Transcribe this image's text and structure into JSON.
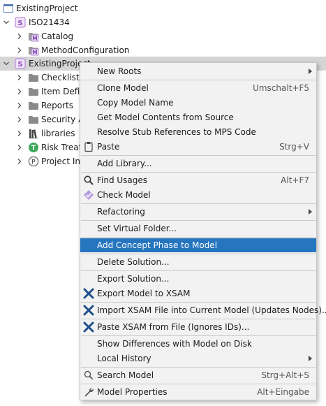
{
  "tree": {
    "root": {
      "label": "ExistingProject",
      "icon": "project-icon"
    },
    "items": [
      {
        "label": "ISO21434",
        "icon": "solution-icon",
        "state": "expanded"
      },
      {
        "label": "Catalog",
        "icon": "model-icon",
        "state": "collapsed"
      },
      {
        "label": "MethodConfiguration",
        "icon": "model-icon",
        "state": "collapsed"
      },
      {
        "label": "ExistingProject",
        "icon": "solution-icon",
        "state": "expanded",
        "selected": true
      },
      {
        "label": "Checklists",
        "icon": "folder-icon",
        "state": "collapsed"
      },
      {
        "label": "Item Defin",
        "icon": "folder-icon",
        "state": "collapsed"
      },
      {
        "label": "Reports",
        "icon": "folder-icon",
        "state": "collapsed"
      },
      {
        "label": "Security An",
        "icon": "folder-icon",
        "state": "collapsed"
      },
      {
        "label": "libraries",
        "icon": "libraries-icon",
        "state": "collapsed"
      },
      {
        "label": "Risk Treatm",
        "icon": "risk-treatment-icon",
        "state": "collapsed"
      },
      {
        "label": "Project Inf",
        "icon": "project-info-icon",
        "state": "collapsed"
      }
    ]
  },
  "menu": {
    "items": [
      {
        "label": "New Roots",
        "submenu": true
      },
      {
        "label": "Clone Model",
        "shortcut": "Umschalt+F5"
      },
      {
        "label": "Copy Model Name"
      },
      {
        "label": "Get Model Contents from Source"
      },
      {
        "label": "Resolve Stub References to MPS Code"
      },
      {
        "label": "Paste",
        "shortcut": "Strg+V",
        "icon": "clipboard-icon"
      },
      {
        "label": "Add Library..."
      },
      {
        "label": "Find Usages",
        "shortcut": "Alt+F7",
        "icon": "magnifier-icon"
      },
      {
        "label": "Check Model",
        "icon": "check-model-icon"
      },
      {
        "label": "Refactoring",
        "submenu": true
      },
      {
        "label": "Set Virtual Folder..."
      },
      {
        "label": "Add Concept Phase to Model",
        "highlighted": true
      },
      {
        "label": "Delete Solution..."
      },
      {
        "label": "Export Solution..."
      },
      {
        "label": "Export Model to XSAM",
        "icon": "xsam-icon"
      },
      {
        "label": "Import XSAM File into Current Model (Updates Nodes)...",
        "icon": "xsam-icon"
      },
      {
        "label": "Paste XSAM from File (Ignores IDs)...",
        "icon": "xsam-icon"
      },
      {
        "label": "Show Differences with Model on Disk"
      },
      {
        "label": "Local History",
        "submenu": true
      },
      {
        "label": "Search Model",
        "shortcut": "Strg+Alt+S",
        "icon": "search-icon"
      },
      {
        "label": "Model Properties",
        "shortcut": "Alt+Eingabe",
        "icon": "wrench-icon"
      }
    ]
  },
  "colors": {
    "highlight": "#2675bf",
    "selection": "#d5d5d5",
    "menu_background": "#f2f2f2",
    "solution_badge": "#b07cd6",
    "folder": "#8a8a8a",
    "xsam_icon": "#1f4f8c"
  }
}
